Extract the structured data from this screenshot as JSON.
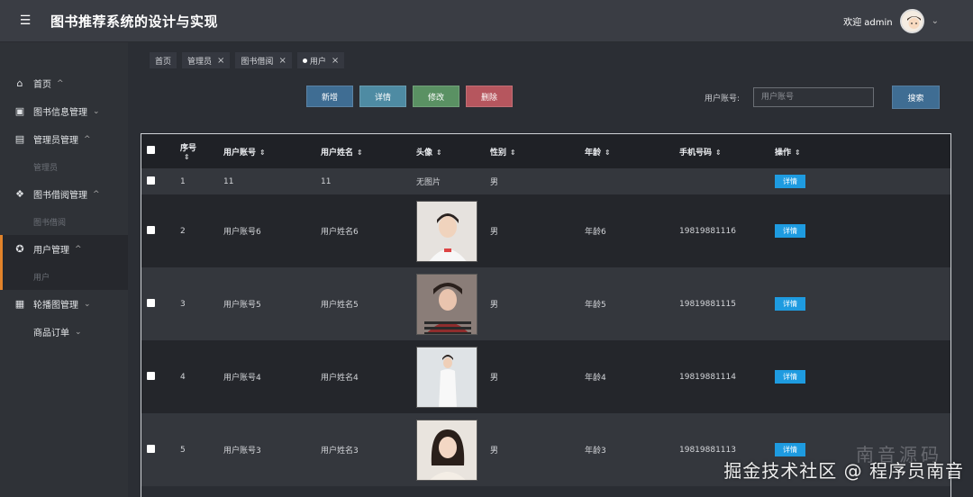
{
  "header": {
    "menu_icon": "menu-icon",
    "title": "图书推荐系统的设计与实现",
    "welcome": "欢迎 admin",
    "chevron": "⌄"
  },
  "sidebar": {
    "items": [
      {
        "label": "首页",
        "icon": "home-icon",
        "chev": "^"
      },
      {
        "label": "图书信息管理",
        "icon": "chip-icon",
        "chev": "⌄"
      },
      {
        "label": "管理员管理",
        "icon": "layout-icon",
        "chev": "^"
      },
      {
        "label": "管理员",
        "sub": true
      },
      {
        "label": "图书借阅管理",
        "icon": "apps-icon",
        "chev": "^"
      },
      {
        "label": "图书借阅",
        "sub": true
      },
      {
        "label": "用户管理",
        "icon": "award-icon",
        "chev": "^"
      },
      {
        "label": "用户",
        "sub": true
      },
      {
        "label": "轮播图管理",
        "icon": "carousel-icon",
        "chev": "⌄"
      },
      {
        "label": "商品订单",
        "chev": "⌄"
      }
    ]
  },
  "tabs": [
    {
      "label": "首页",
      "closable": false
    },
    {
      "label": "管理员",
      "closable": true
    },
    {
      "label": "图书借阅",
      "closable": true
    },
    {
      "label": "用户",
      "closable": true,
      "current": true
    }
  ],
  "toolbar": {
    "add": "新增",
    "detail": "详情",
    "edit": "修改",
    "delete": "删除",
    "search_label": "用户账号:",
    "search_placeholder": "用户账号",
    "search_button": "搜索"
  },
  "table": {
    "headers": [
      "",
      "序号",
      "用户账号",
      "用户姓名",
      "头像",
      "性别",
      "年龄",
      "手机号码",
      "操作"
    ],
    "rows": [
      {
        "no": "1",
        "account": "11",
        "name": "11",
        "avatar": "无图片",
        "gender": "男",
        "age": "",
        "phone": "",
        "action": "详情"
      },
      {
        "no": "2",
        "account": "用户账号6",
        "name": "用户姓名6",
        "avatar": "img",
        "gender": "男",
        "age": "年龄6",
        "phone": "19819881116",
        "action": "详情"
      },
      {
        "no": "3",
        "account": "用户账号5",
        "name": "用户姓名5",
        "avatar": "img",
        "gender": "男",
        "age": "年龄5",
        "phone": "19819881115",
        "action": "详情"
      },
      {
        "no": "4",
        "account": "用户账号4",
        "name": "用户姓名4",
        "avatar": "img",
        "gender": "男",
        "age": "年龄4",
        "phone": "19819881114",
        "action": "详情"
      },
      {
        "no": "5",
        "account": "用户账号3",
        "name": "用户姓名3",
        "avatar": "img",
        "gender": "男",
        "age": "年龄3",
        "phone": "19819881113",
        "action": "详情"
      }
    ]
  },
  "watermark": {
    "main": "掘金技术社区 @ 程序员南音",
    "faint": "南音源码"
  },
  "colors": {
    "accent": "#e2832a",
    "primary_button": "#3f6d93",
    "detail_button": "#1e9be0"
  }
}
